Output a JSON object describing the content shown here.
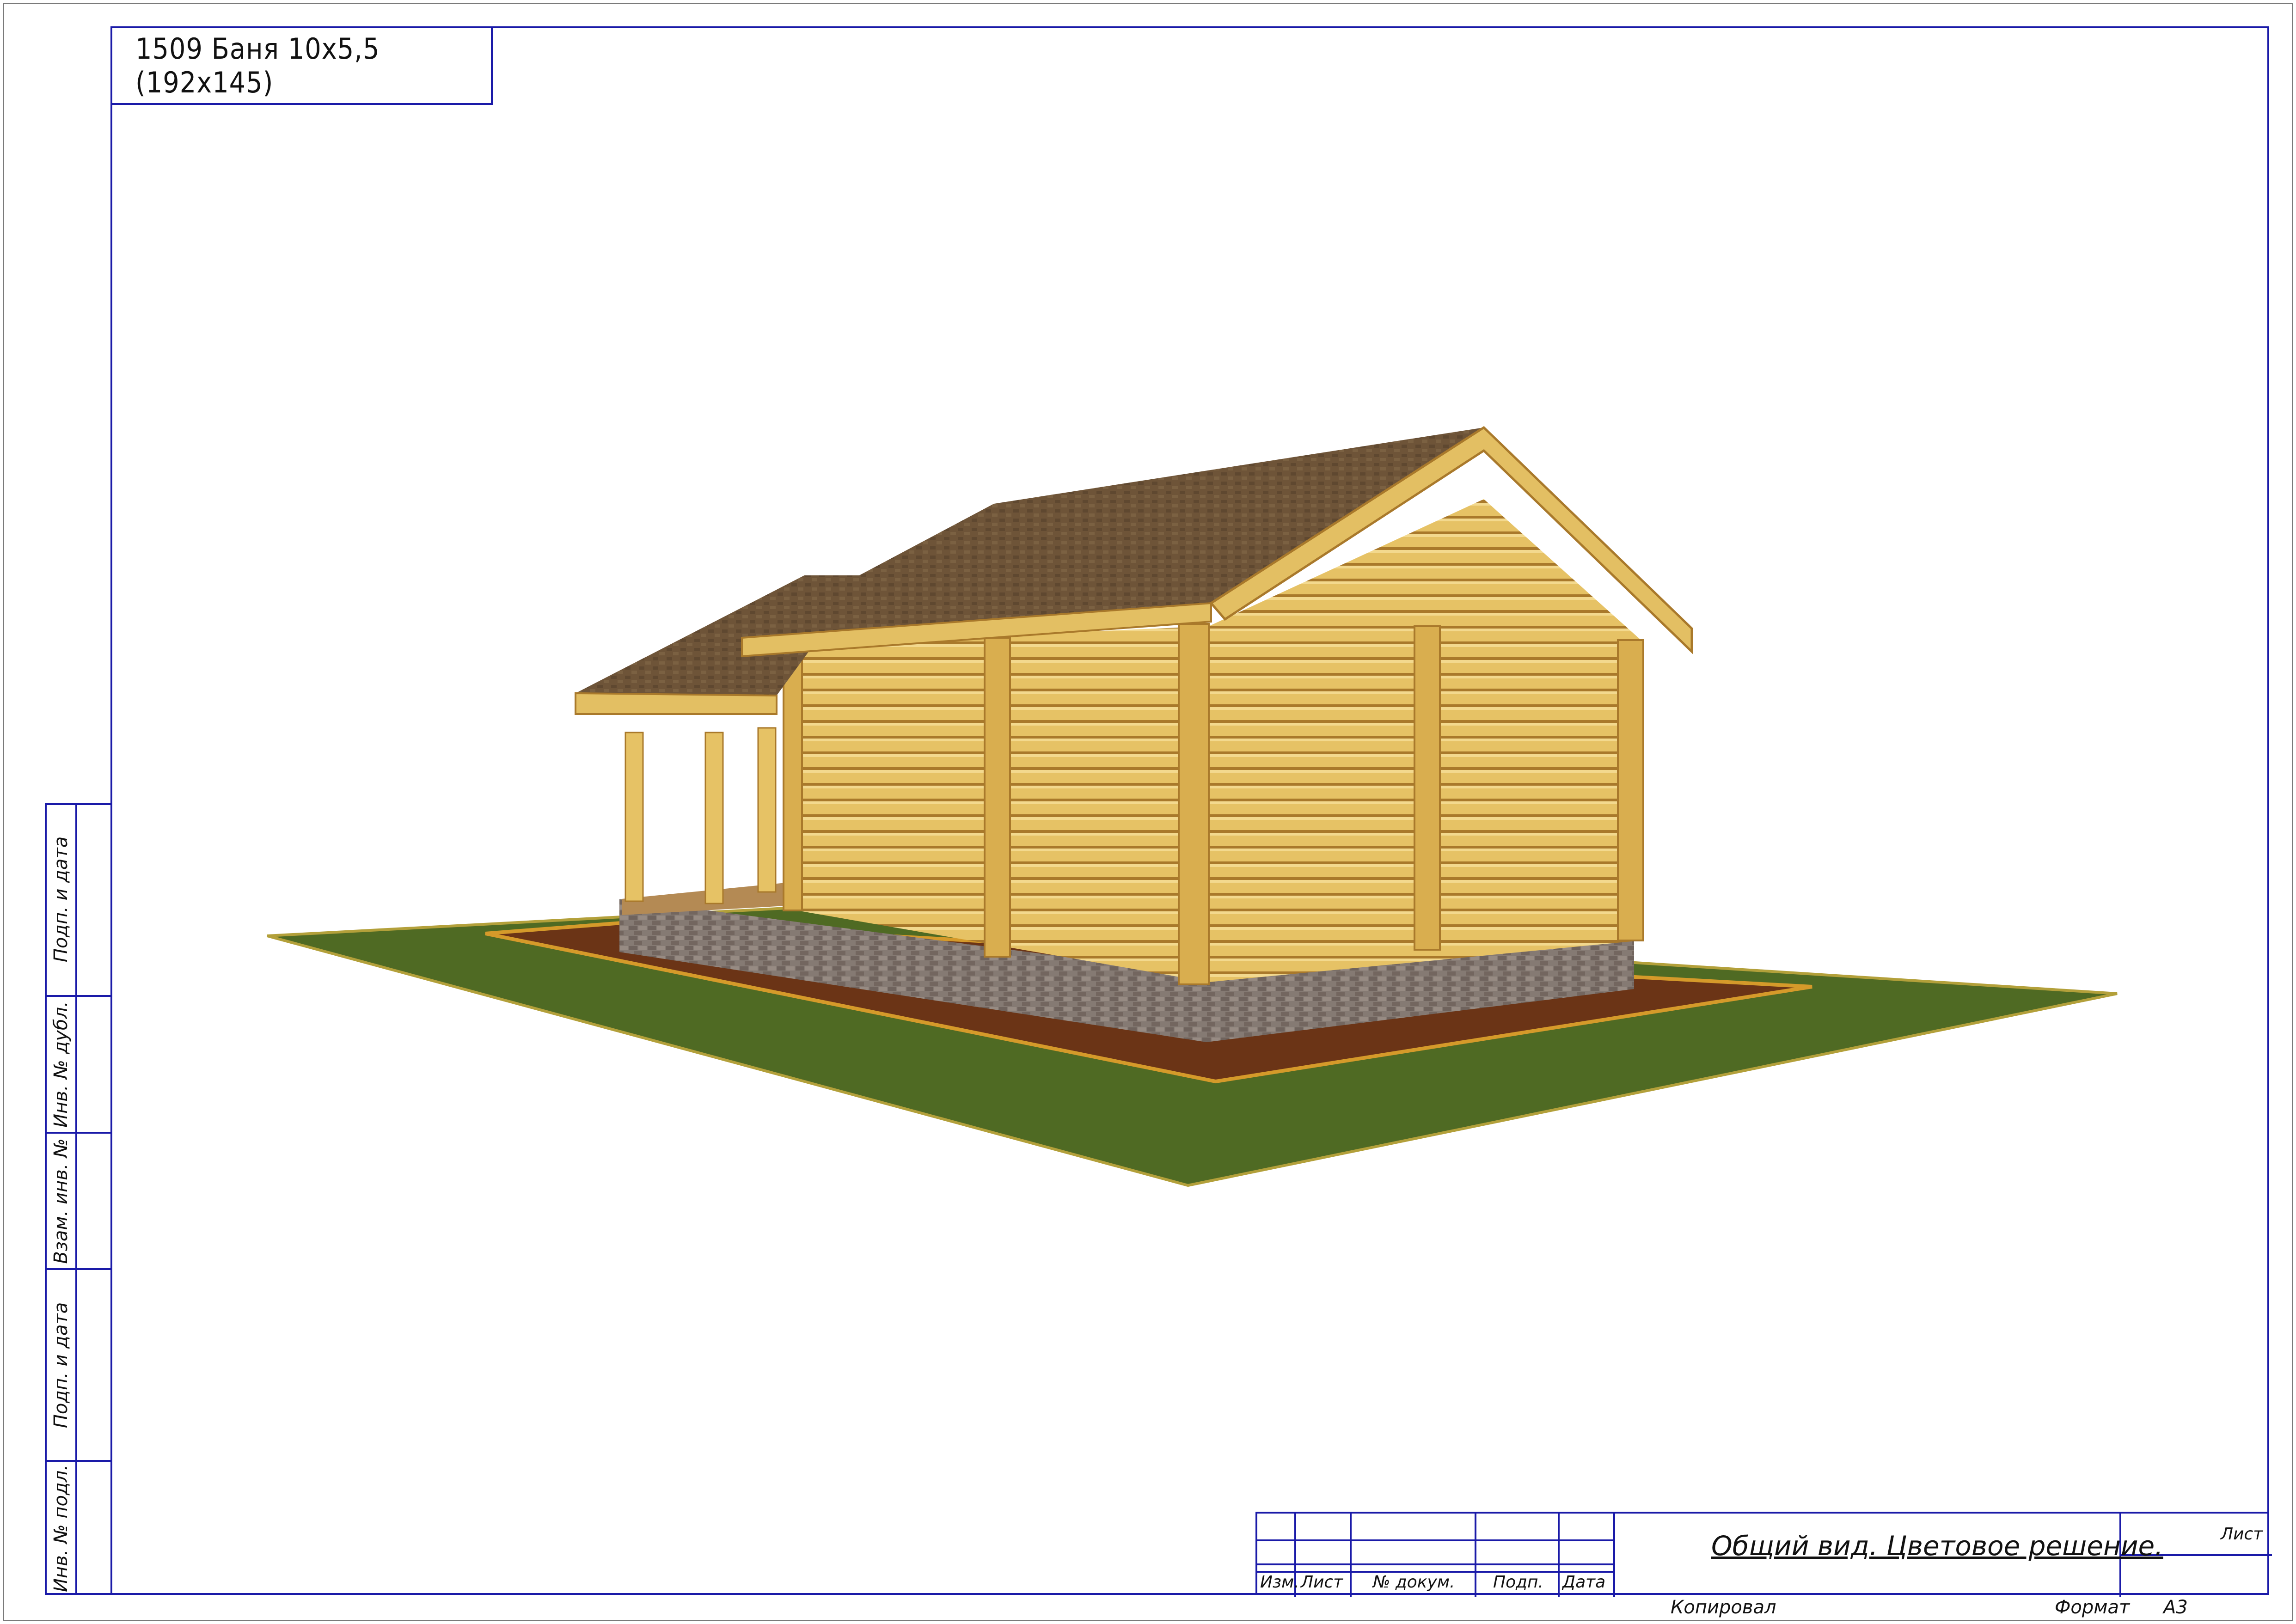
{
  "drawing": {
    "title": "1509 Баня 10х5,5 (192х145)"
  },
  "side_strip": {
    "cells": [
      {
        "label": "Подп. и дата"
      },
      {
        "label": "Инв. № дубл."
      },
      {
        "label": "Взам. инв. №"
      },
      {
        "label": "Подп. и дата"
      },
      {
        "label": "Инв. № подл."
      }
    ]
  },
  "title_block": {
    "columns": [
      "Изм.",
      "Лист",
      "№ докум.",
      "Подп.",
      "Дата"
    ],
    "sheet_title": "Общий вид. Цветовое решение.",
    "sheet_label": "Лист",
    "copied_label": "Копировал",
    "format_label": "Формат",
    "format_value": "А3"
  },
  "colors": {
    "frame": "#1a1aa8",
    "grass": "#4f6a23",
    "soil": "#6b3416",
    "roof": "#6e5438",
    "log": "#e3bf63",
    "stone": "#7f726b"
  }
}
